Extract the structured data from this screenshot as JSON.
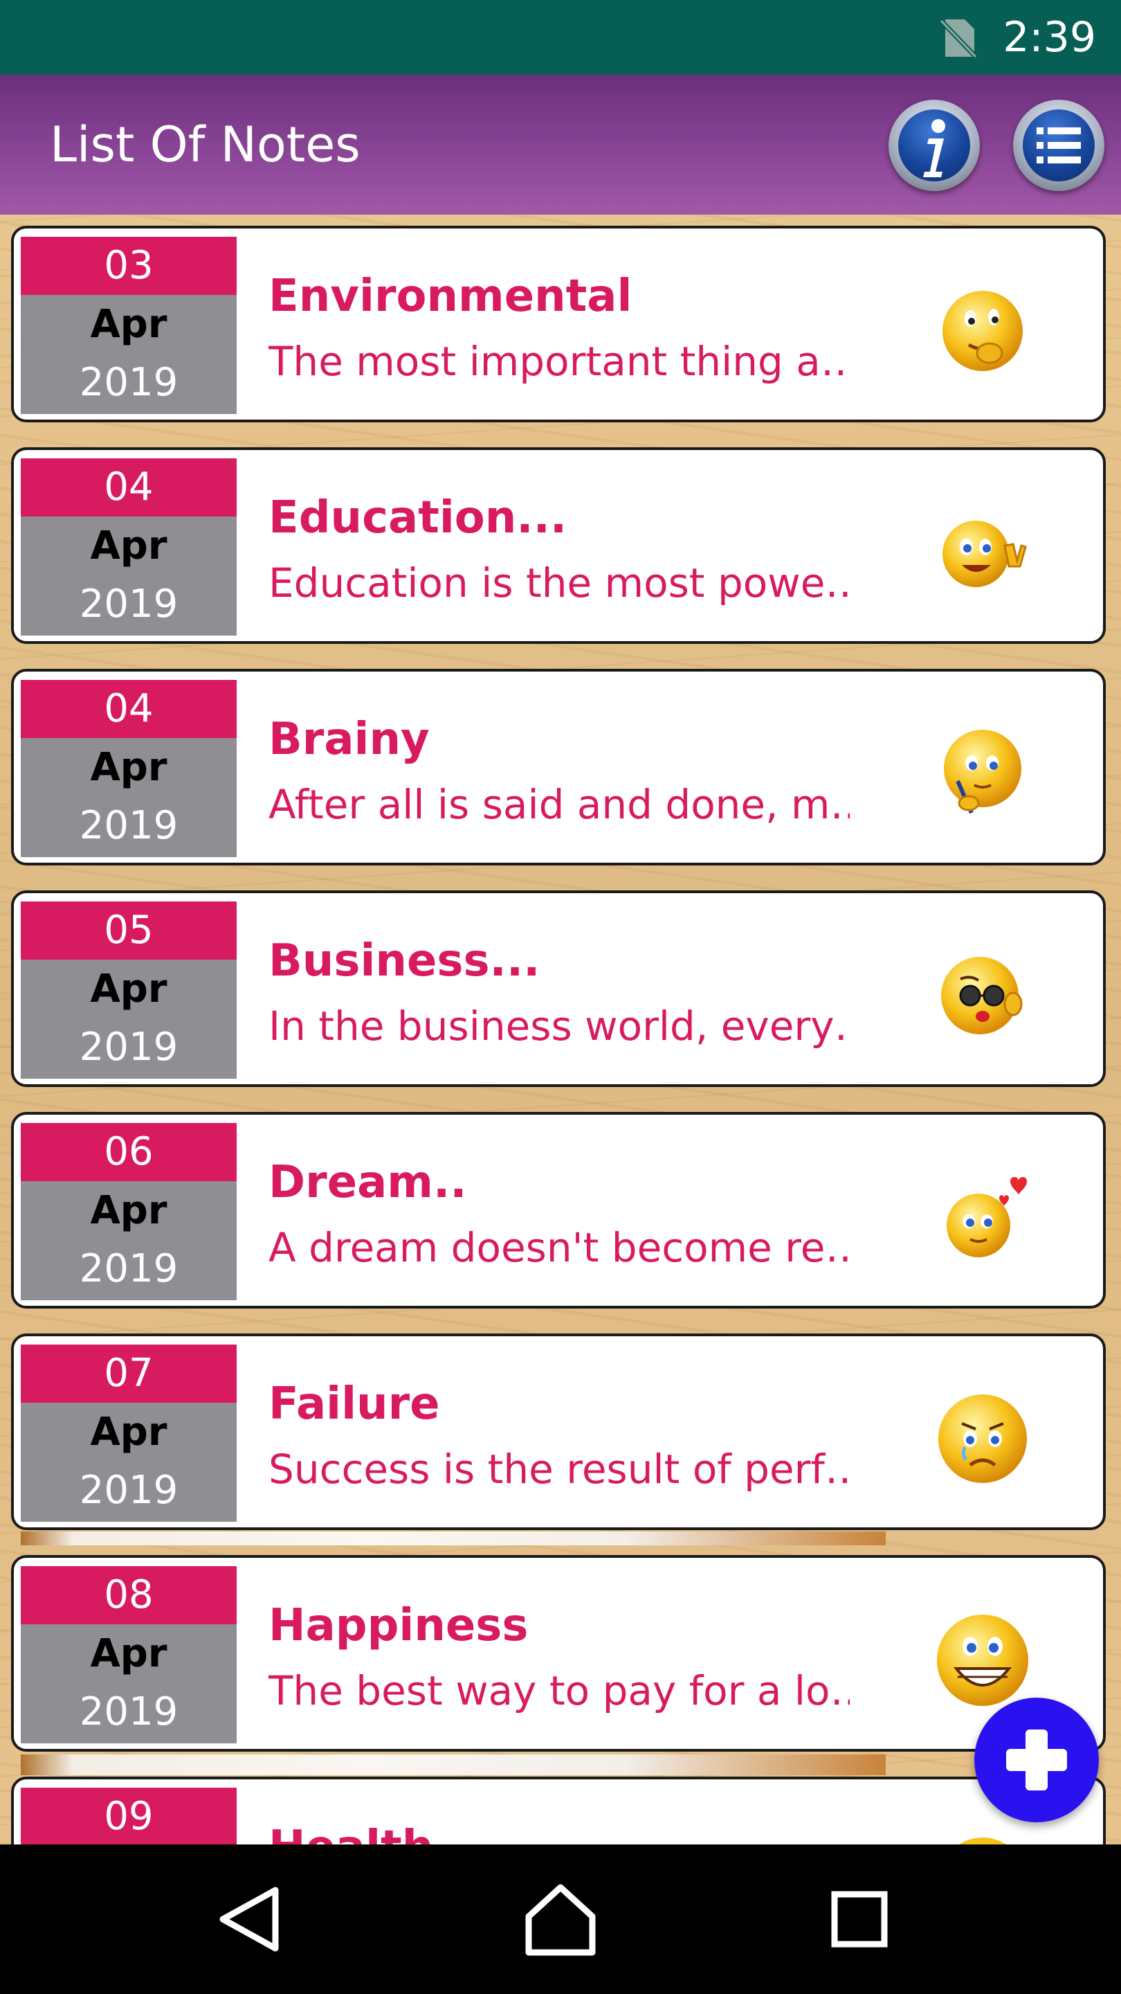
{
  "status_bar": {
    "time": "2:39",
    "sim_icon": "no-sim-icon",
    "background": "#075e54"
  },
  "app_bar": {
    "title": "List Of Notes",
    "info_button_icon": "info-icon",
    "list_button_icon": "list-icon"
  },
  "notes": [
    {
      "day": "03",
      "month": "Apr",
      "year": "2019",
      "title": "Environmental",
      "preview": "The most important thing a…",
      "emoji": "shy-smile-emoji"
    },
    {
      "day": "04",
      "month": "Apr",
      "year": "2019",
      "title": "Education...",
      "preview": "Education is the most powe…",
      "emoji": "peace-sign-emoji"
    },
    {
      "day": "04",
      "month": "Apr",
      "year": "2019",
      "title": "Brainy",
      "preview": "After all is said and done, m…",
      "emoji": "writing-emoji"
    },
    {
      "day": "05",
      "month": "Apr",
      "year": "2019",
      "title": "Business...",
      "preview": "In the business world, every…",
      "emoji": "sunglasses-wink-emoji"
    },
    {
      "day": "06",
      "month": "Apr",
      "year": "2019",
      "title": "Dream..",
      "preview": "A dream doesn't become re…",
      "emoji": "dreamy-heart-emoji"
    },
    {
      "day": "07",
      "month": "Apr",
      "year": "2019",
      "title": "Failure",
      "preview": "Success is the result of perf…",
      "emoji": "crying-emoji"
    },
    {
      "day": "08",
      "month": "Apr",
      "year": "2019",
      "title": "Happiness",
      "preview": "The best way to pay for a lo…",
      "emoji": "big-grin-emoji"
    },
    {
      "day": "09",
      "month": "",
      "year": "",
      "title": "Health",
      "preview": "",
      "emoji": "smile-emoji"
    }
  ],
  "fab": {
    "icon": "plus-icon",
    "color": "#2a12f0"
  },
  "nav_bar": {
    "back_icon": "back-triangle-icon",
    "home_icon": "home-icon",
    "recent_icon": "recent-apps-icon"
  },
  "colors": {
    "accent": "#d81b60",
    "date_gray": "#8e8e93",
    "app_bar_purple": "#8a4596"
  }
}
